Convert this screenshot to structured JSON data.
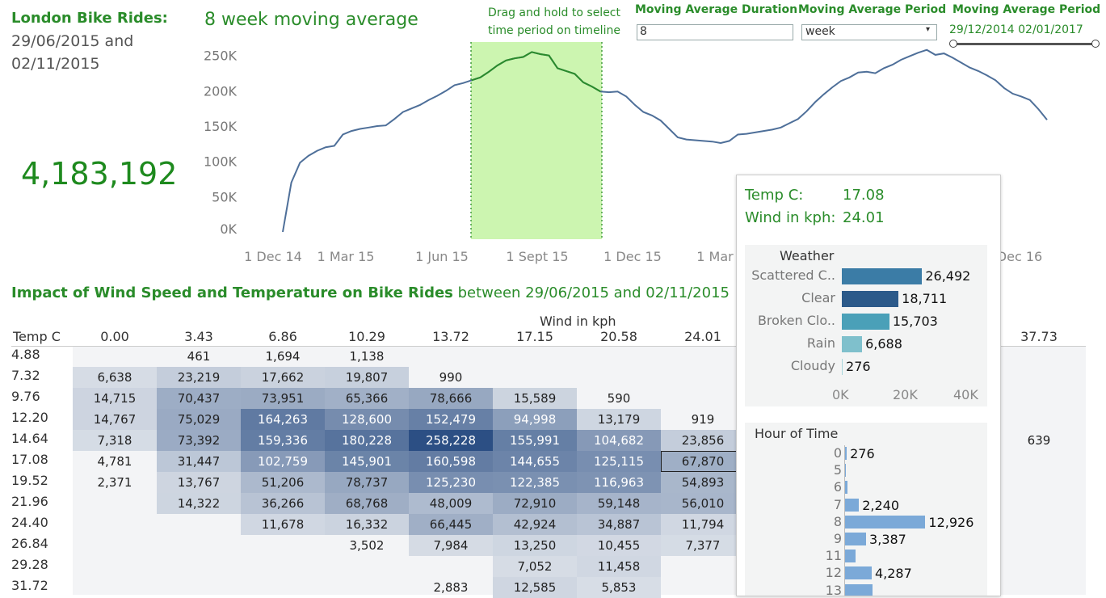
{
  "header": {
    "title": "London Bike Rides:",
    "date_from": "29/06/2015 and",
    "date_to": "02/11/2015",
    "total": "4,183,192"
  },
  "line_chart": {
    "title": "8 week moving average",
    "drag_note_line1": "Drag and hold to select",
    "drag_note_line2": "time period on timeline",
    "y_ticks": [
      "250K",
      "200K",
      "150K",
      "100K",
      "50K",
      "0K"
    ],
    "x_ticks": [
      "1 Dec 14",
      "1 Mar 15",
      "1 Jun 15",
      "1 Sept 15",
      "1 Dec 15",
      "1 Mar",
      "Dec 16"
    ],
    "line_color": "#4e6f99",
    "highlight_line_color": "#2a8c2a",
    "selection_color": "#ccf5b0"
  },
  "controls": {
    "duration_label": "Moving Average Duration",
    "duration_value": "8",
    "period_label": "Moving Average Period",
    "period_value": "week",
    "range_label": "Moving Average Period",
    "range_dates": "29/12/2014 02/01/2017"
  },
  "chart_data": {
    "type": "line",
    "title": "8 week moving average",
    "ylim": [
      0,
      260000
    ],
    "x_start": "2014-12-01",
    "x_end": "2016-12-31",
    "series": [
      {
        "values": [
          0,
          70000,
          98000,
          108000,
          115000,
          120000,
          122000,
          138000,
          143000,
          146000,
          148000,
          150000,
          151000,
          160000,
          170000,
          175000,
          180000,
          187000,
          193000,
          200000,
          208000,
          211000,
          215000,
          219000,
          227000,
          236000,
          243000,
          246000,
          248000,
          255000,
          252000,
          250000,
          232000,
          228000,
          224000,
          212000,
          206000,
          199000,
          198000,
          199000,
          192000,
          180000,
          170000,
          165000,
          158000,
          146000,
          134000,
          131000,
          130000,
          129000,
          128000,
          126000,
          129000,
          138000,
          139000,
          141000,
          143000,
          145000,
          148000,
          154000,
          160000,
          171000,
          184000,
          195000,
          205000,
          214000,
          219000,
          226000,
          227000,
          225000,
          232000,
          237000,
          244000,
          249000,
          254000,
          258000,
          251000,
          253000,
          247000,
          240000,
          233000,
          228000,
          222000,
          215000,
          204000,
          196000,
          192000,
          187000,
          174000,
          159000
        ]
      }
    ],
    "selection": [
      "29/06/2015",
      "02/11/2015"
    ]
  },
  "heatmap": {
    "title_bold": "Impact of Wind Speed and Temperature on Bike Rides",
    "title_rest": "between 29/06/2015 and 02/11/2015",
    "wind_label": "Wind in kph",
    "temp_label": "Temp C",
    "columns": [
      "0.00",
      "3.43",
      "6.86",
      "10.29",
      "13.72",
      "17.15",
      "20.58",
      "24.01",
      "",
      "",
      "",
      "37.73"
    ],
    "rows": [
      {
        "temp": "4.88",
        "cells": [
          "",
          "461",
          "1,694",
          "1,138",
          "",
          "",
          "",
          "",
          "",
          "",
          "",
          ""
        ]
      },
      {
        "temp": "7.32",
        "cells": [
          "6,638",
          "23,219",
          "17,662",
          "19,807",
          "990",
          "",
          "",
          "",
          "",
          "",
          "",
          ""
        ]
      },
      {
        "temp": "9.76",
        "cells": [
          "14,715",
          "70,437",
          "73,951",
          "65,366",
          "78,666",
          "15,589",
          "590",
          "",
          "",
          "",
          "",
          ""
        ]
      },
      {
        "temp": "12.20",
        "cells": [
          "14,767",
          "75,029",
          "164,263",
          "128,600",
          "152,479",
          "94,998",
          "13,179",
          "919",
          "",
          "",
          "",
          ""
        ]
      },
      {
        "temp": "14.64",
        "cells": [
          "7,318",
          "73,392",
          "159,336",
          "180,228",
          "258,228",
          "155,991",
          "104,682",
          "23,856",
          "",
          "",
          "",
          "639"
        ]
      },
      {
        "temp": "17.08",
        "cells": [
          "4,781",
          "31,447",
          "102,759",
          "145,901",
          "160,598",
          "144,655",
          "125,115",
          "67,870",
          "",
          "",
          "",
          ""
        ]
      },
      {
        "temp": "19.52",
        "cells": [
          "2,371",
          "13,767",
          "51,206",
          "78,737",
          "125,230",
          "122,385",
          "116,963",
          "54,893",
          "",
          "",
          "",
          ""
        ]
      },
      {
        "temp": "21.96",
        "cells": [
          "",
          "14,322",
          "36,266",
          "68,768",
          "48,009",
          "72,910",
          "59,148",
          "56,010",
          "",
          "",
          "",
          ""
        ]
      },
      {
        "temp": "24.40",
        "cells": [
          "",
          "",
          "11,678",
          "16,332",
          "66,445",
          "42,924",
          "34,887",
          "11,794",
          "",
          "",
          "",
          ""
        ]
      },
      {
        "temp": "26.84",
        "cells": [
          "",
          "",
          "",
          "3,502",
          "7,984",
          "13,250",
          "10,455",
          "7,377",
          "",
          "",
          "",
          ""
        ]
      },
      {
        "temp": "29.28",
        "cells": [
          "",
          "",
          "",
          "",
          "",
          "7,052",
          "11,458",
          "",
          "",
          "",
          "",
          ""
        ]
      },
      {
        "temp": "31.72",
        "cells": [
          "",
          "",
          "",
          "",
          "2,883",
          "12,585",
          "5,853",
          "",
          "",
          "",
          "",
          ""
        ]
      }
    ],
    "selected_cell": {
      "row": 5,
      "col": 7
    }
  },
  "tooltip": {
    "temp_label": "Temp C:",
    "temp_value": "17.08",
    "wind_label": "Wind in kph:",
    "wind_value": "24.01",
    "weather_title": "Weather",
    "weather": [
      {
        "label": "Scattered C..",
        "value": "26,492",
        "num": 26492,
        "color": "#3b7ca6"
      },
      {
        "label": "Clear",
        "value": "18,711",
        "num": 18711,
        "color": "#2c5a8a"
      },
      {
        "label": "Broken Clo..",
        "value": "15,703",
        "num": 15703,
        "color": "#4aa0b8"
      },
      {
        "label": "Rain",
        "value": "6,688",
        "num": 6688,
        "color": "#7fc0cc"
      },
      {
        "label": "Cloudy",
        "value": "276",
        "num": 276,
        "color": "#a8d6dc"
      }
    ],
    "weather_axis": [
      "0K",
      "20K",
      "40K"
    ],
    "hour_title": "Hour of Time",
    "hours": [
      {
        "label": "0",
        "value": "276",
        "num": 276
      },
      {
        "label": "5",
        "value": "",
        "num": 30
      },
      {
        "label": "6",
        "value": "",
        "num": 400
      },
      {
        "label": "7",
        "value": "2,240",
        "num": 2240
      },
      {
        "label": "8",
        "value": "12,926",
        "num": 12926
      },
      {
        "label": "9",
        "value": "3,387",
        "num": 3387
      },
      {
        "label": "11",
        "value": "",
        "num": 1700
      },
      {
        "label": "12",
        "value": "4,287",
        "num": 4287
      },
      {
        "label": "13",
        "value": "",
        "num": 4400
      }
    ],
    "hour_bar_color": "#7ba9d8"
  }
}
